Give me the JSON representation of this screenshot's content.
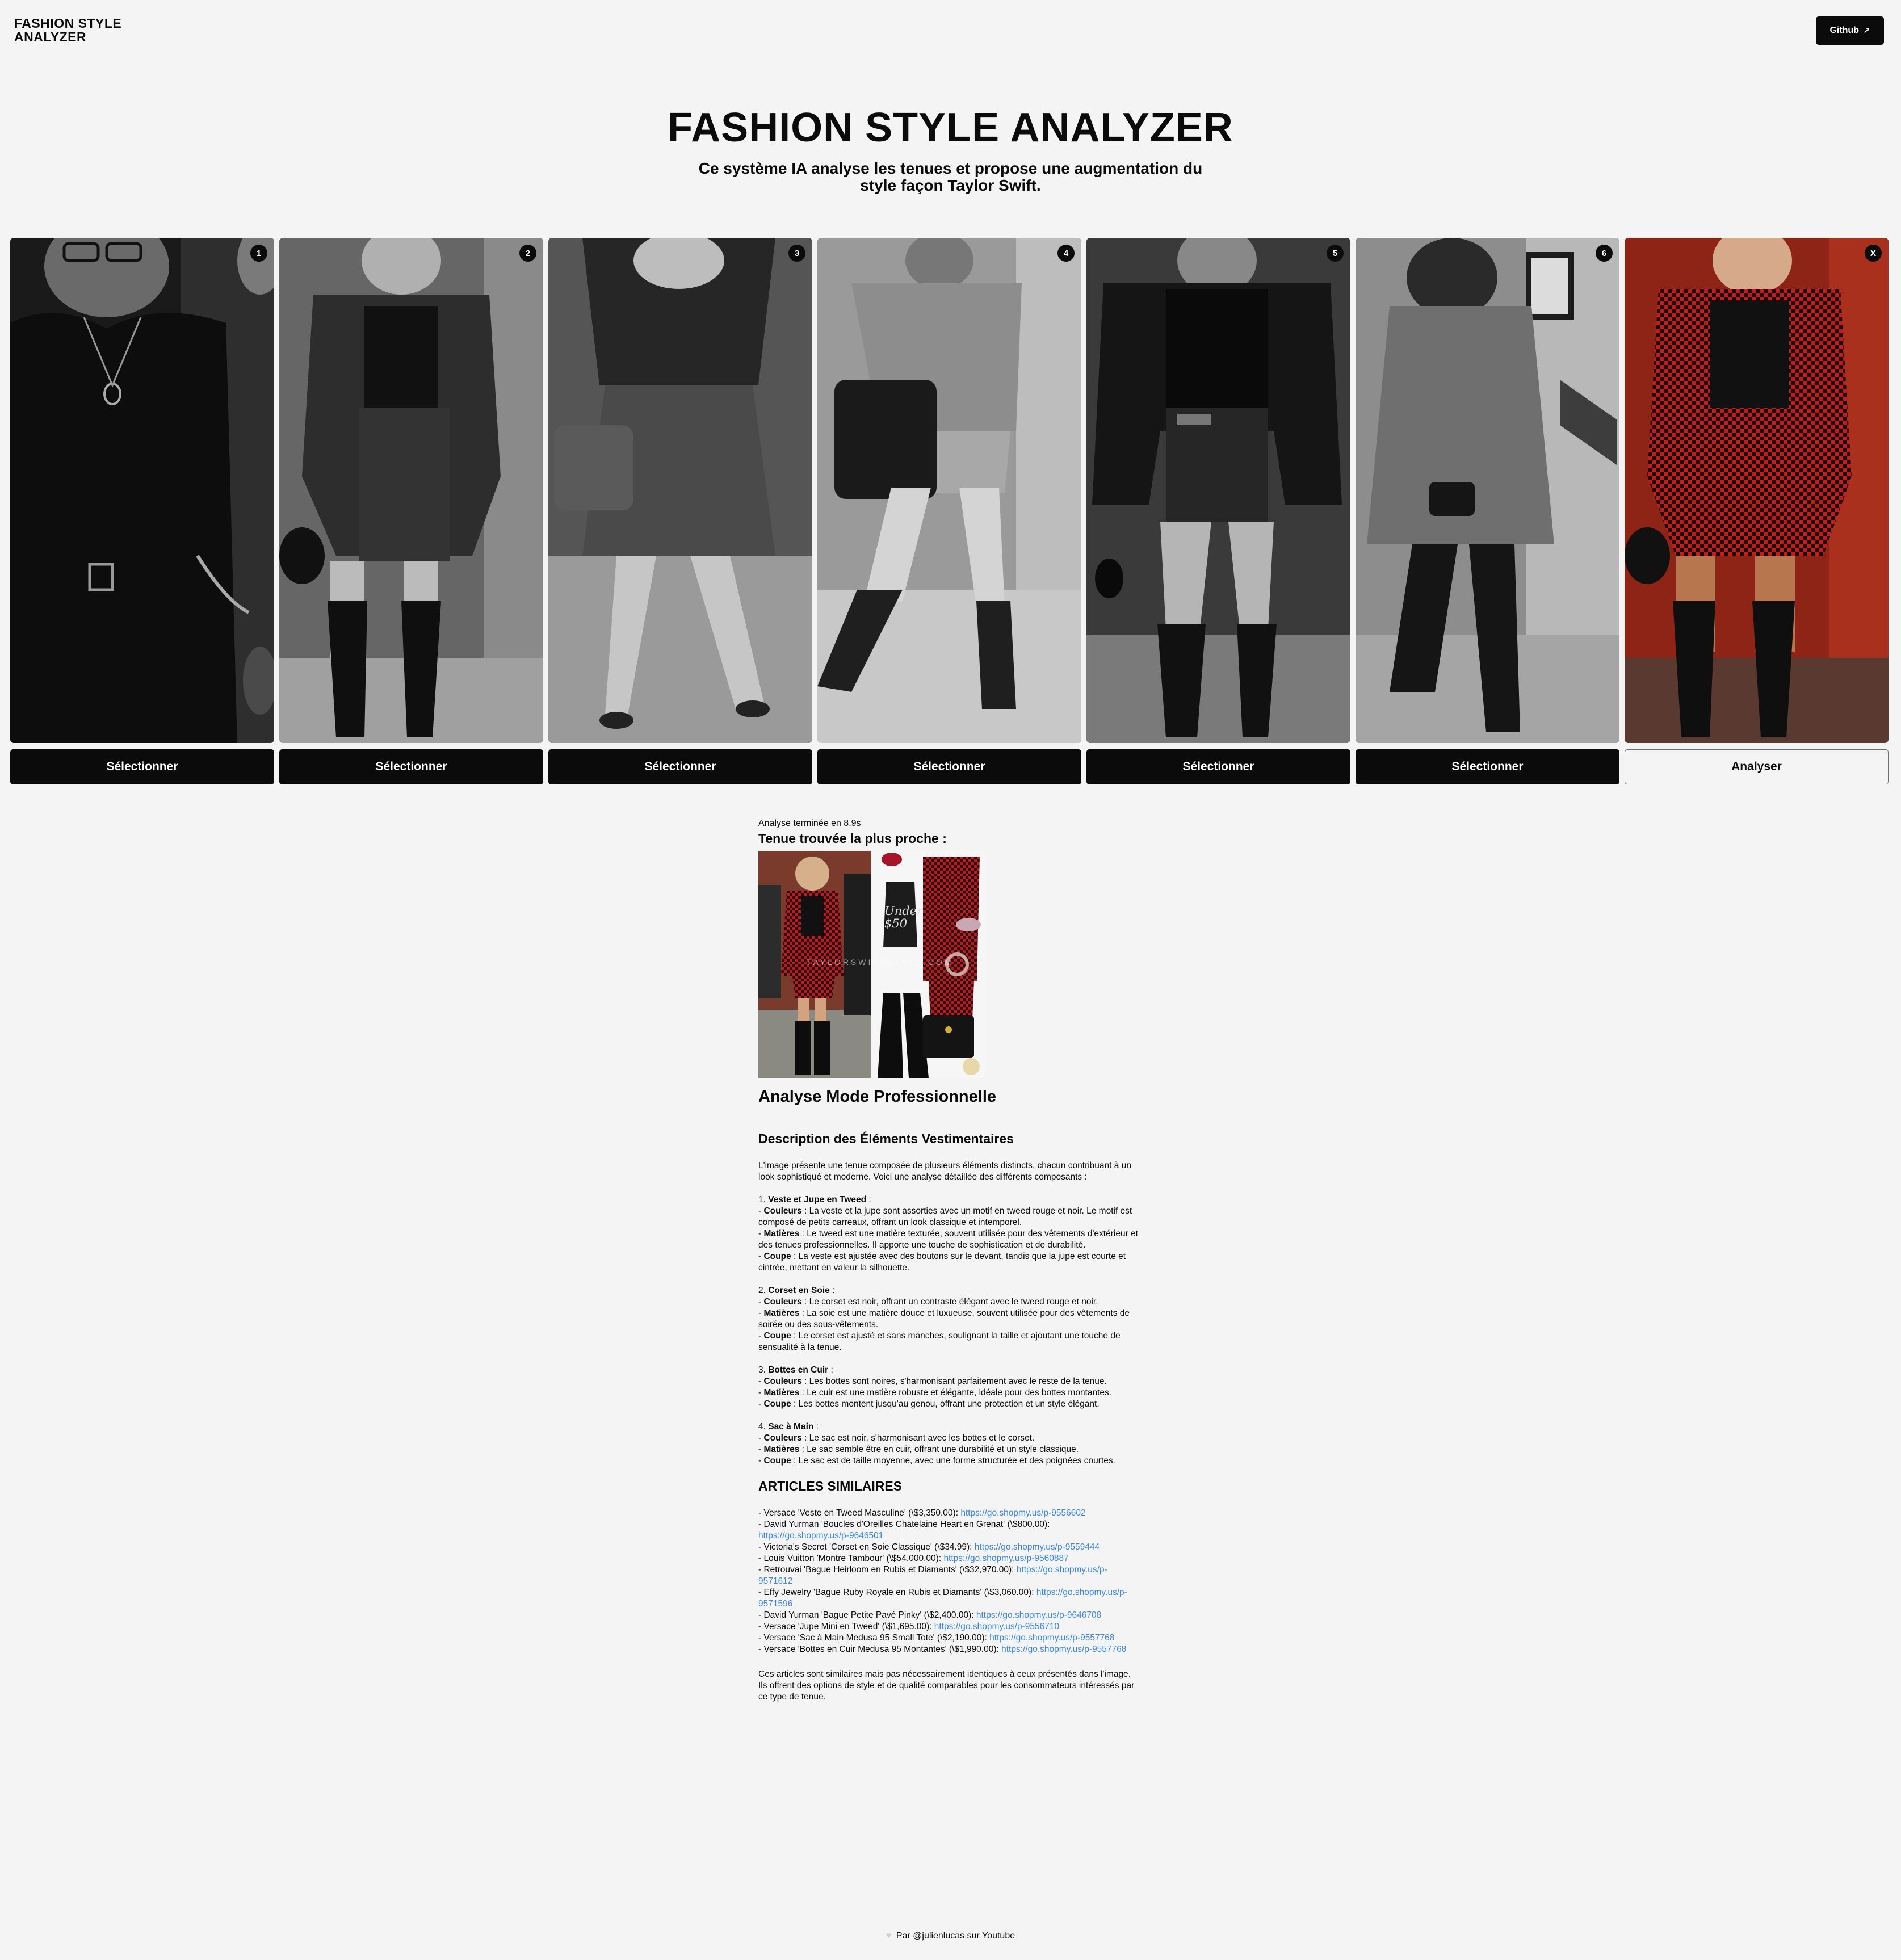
{
  "header": {
    "logo": "FASHION STYLE ANALYZER",
    "github_label": "Github",
    "github_icon": "arrow-up-right-icon"
  },
  "hero": {
    "title": "FASHION STYLE ANALYZER",
    "subtitle": "Ce système IA analyse les tenues et propose une augmentation du style façon Taylor Swift."
  },
  "gallery": [
    {
      "badge": "1",
      "button": "Sélectionner"
    },
    {
      "badge": "2",
      "button": "Sélectionner"
    },
    {
      "badge": "3",
      "button": "Sélectionner"
    },
    {
      "badge": "4",
      "button": "Sélectionner"
    },
    {
      "badge": "5",
      "button": "Sélectionner"
    },
    {
      "badge": "6",
      "button": "Sélectionner"
    },
    {
      "badge": "X",
      "button": "Analyser"
    }
  ],
  "result": {
    "status": "Analyse terminée en 8.9s",
    "nearest_heading": "Tenue trouvée la plus proche :",
    "match_watermark": "TAYLORSWIFTSTYLE.COM",
    "match_tag": "Under $50",
    "analysis_heading": "Analyse Mode Professionnelle",
    "description_heading": "Description des Éléments Vestimentaires",
    "intro": "L'image présente une tenue composée de plusieurs éléments distincts, chacun contribuant à un look sophistiqué et moderne. Voici une analyse détaillée des différents composants :",
    "sections": [
      {
        "num": "1.",
        "title": "Veste et Jupe en Tweed",
        "items": [
          {
            "label": "Couleurs",
            "text": " : La veste et la jupe sont assorties avec un motif en tweed rouge et noir. Le motif est composé de petits carreaux, offrant un look classique et intemporel."
          },
          {
            "label": "Matières",
            "text": " : Le tweed est une matière texturée, souvent utilisée pour des vêtements d'extérieur et des tenues professionnelles. Il apporte une touche de sophistication et de durabilité."
          },
          {
            "label": "Coupe",
            "text": " : La veste est ajustée avec des boutons sur le devant, tandis que la jupe est courte et cintrée, mettant en valeur la silhouette."
          }
        ]
      },
      {
        "num": "2.",
        "title": "Corset en Soie",
        "items": [
          {
            "label": "Couleurs",
            "text": " : Le corset est noir, offrant un contraste élégant avec le tweed rouge et noir."
          },
          {
            "label": "Matières",
            "text": " : La soie est une matière douce et luxueuse, souvent utilisée pour des vêtements de soirée ou des sous-vêtements."
          },
          {
            "label": "Coupe",
            "text": " : Le corset est ajusté et sans manches, soulignant la taille et ajoutant une touche de sensualité à la tenue."
          }
        ]
      },
      {
        "num": "3.",
        "title": "Bottes en Cuir",
        "items": [
          {
            "label": "Couleurs",
            "text": " : Les bottes sont noires, s'harmonisant parfaitement avec le reste de la tenue."
          },
          {
            "label": "Matières",
            "text": " : Le cuir est une matière robuste et élégante, idéale pour des bottes montantes."
          },
          {
            "label": "Coupe",
            "text": " : Les bottes montent jusqu'au genou, offrant une protection et un style élégant."
          }
        ]
      },
      {
        "num": "4.",
        "title": "Sac à Main",
        "items": [
          {
            "label": "Couleurs",
            "text": " : Le sac est noir, s'harmonisant avec les bottes et le corset."
          },
          {
            "label": "Matières",
            "text": " : Le sac semble être en cuir, offrant une durabilité et un style classique."
          },
          {
            "label": "Coupe",
            "text": " : Le sac est de taille moyenne, avec une forme structurée et des poignées courtes."
          }
        ]
      }
    ],
    "articles_heading": "ARTICLES SIMILAIRES",
    "articles": [
      {
        "text": "- Versace 'Veste en Tweed Masculine' (\\$3,350.00): ",
        "url": "https://go.shopmy.us/p-9556602"
      },
      {
        "text": "- David Yurman 'Boucles d'Oreilles Chatelaine Heart en Grenat' (\\$800.00): ",
        "url": "https://go.shopmy.us/p-9646501"
      },
      {
        "text": "- Victoria's Secret 'Corset en Soie Classique' (\\$34.99): ",
        "url": "https://go.shopmy.us/p-9559444"
      },
      {
        "text": "- Louis Vuitton 'Montre Tambour' (\\$54,000.00): ",
        "url": "https://go.shopmy.us/p-9560887"
      },
      {
        "text": "- Retrouvai 'Bague Heirloom en Rubis et Diamants' (\\$32,970.00): ",
        "url": "https://go.shopmy.us/p-9571612"
      },
      {
        "text": "- Effy Jewelry 'Bague Ruby Royale en Rubis et Diamants' (\\$3,060.00): ",
        "url": "https://go.shopmy.us/p-9571596"
      },
      {
        "text": "- David Yurman 'Bague Petite Pavé Pinky' (\\$2,400.00): ",
        "url": "https://go.shopmy.us/p-9646708"
      },
      {
        "text": "- Versace 'Jupe Mini en Tweed' (\\$1,695.00): ",
        "url": "https://go.shopmy.us/p-9556710"
      },
      {
        "text": "- Versace 'Sac à Main Medusa 95 Small Tote' (\\$2,190.00): ",
        "url": "https://go.shopmy.us/p-9557768"
      },
      {
        "text": "- Versace 'Bottes en Cuir Medusa 95 Montantes' (\\$1,990.00): ",
        "url": "https://go.shopmy.us/p-9557768"
      }
    ],
    "conclusion": "Ces articles sont similaires mais pas nécessairement identiques à ceux présentés dans l'image. Ils offrent des options de style et de qualité comparables pour les consommateurs intéressés par ce type de tenue."
  },
  "footer": {
    "text": "Par @julienlucas sur Youtube",
    "icon": "heart-icon"
  }
}
